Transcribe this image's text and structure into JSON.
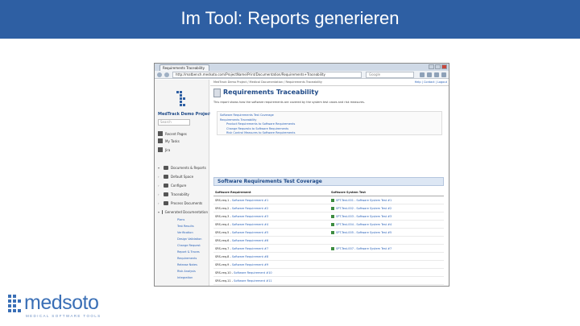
{
  "slide": {
    "title": "Im Tool: Reports generieren",
    "accent_color": "#2e5fa3"
  },
  "browser": {
    "tab_title": "Requirements Traceability",
    "url": "http://matbench.medsoto.com/ProjectName/Print/Documentation/Requirements+Traceability",
    "search_placeholder": "Google"
  },
  "sidebar": {
    "project_name": "MedTrack Demo Project",
    "search_placeholder": "Search",
    "items": [
      {
        "label": "Recent Pages",
        "icon": "clock-icon"
      },
      {
        "label": "My Tasks",
        "icon": "tasks-icon"
      },
      {
        "label": "Jira",
        "icon": "jira-icon"
      }
    ],
    "tree_root": "Documents & Reports",
    "tree": [
      {
        "label": "Default Space"
      },
      {
        "label": "Configure"
      },
      {
        "label": "Traceability"
      },
      {
        "label": "Process Documents"
      },
      {
        "label": "Generated Documentation"
      }
    ],
    "subitems": [
      "Plans",
      "Test Results",
      "Verification",
      "Design Validation",
      "Change Request",
      "Report & Traces",
      "Requirements",
      "Release Notes",
      "Risk Analysis",
      "Integration"
    ]
  },
  "main": {
    "breadcrumb": "MedTrack Demo Project / Medical Documentation / Requirements Traceability",
    "top_links": "Help | Contact | Logout",
    "page_title": "Requirements Traceability",
    "intro": "This report shows how the software requirements are covered by the system test cases and risk measures.",
    "toc": [
      {
        "label": "Software Requirements Test Coverage",
        "level": 1
      },
      {
        "label": "Requirements Traceability",
        "level": 1
      },
      {
        "label": "Product Requirements to Software Requirements",
        "level": 2
      },
      {
        "label": "Change Requests to Software Requirements",
        "level": 2
      },
      {
        "label": "Risk Control Measures to Software Requirements",
        "level": 2
      }
    ],
    "section_title": "Software Requirements Test Coverage",
    "columns": [
      "Software Requirement",
      "Software System Test"
    ],
    "rows": [
      {
        "id": "SRS-req-1",
        "title": "Software Requirement #1",
        "test": "SPT-Test-001 - Software System Test #1"
      },
      {
        "id": "SRS-req-2",
        "title": "Software Requirement #2",
        "test": "SPT-Test-002 - Software System Test #2"
      },
      {
        "id": "SRS-req-3",
        "title": "Software Requirement #3",
        "test": "SPT-Test-003 - Software System Test #3"
      },
      {
        "id": "SRS-req-4",
        "title": "Software Requirement #4",
        "test": "SPT-Test-004 - Software System Test #4"
      },
      {
        "id": "SRS-req-5",
        "title": "Software Requirement #5",
        "test": "SPT-Test-005 - Software System Test #5"
      },
      {
        "id": "SRS-req-6",
        "title": "Software Requirement #6",
        "test": ""
      },
      {
        "id": "SRS-req-7",
        "title": "Software Requirement #7",
        "test": "SPT-Test-007 - Software System Test #7"
      },
      {
        "id": "SRS-req-8",
        "title": "Software Requirement #8",
        "test": ""
      },
      {
        "id": "SRS-req-9",
        "title": "Software Requirement #9",
        "test": ""
      },
      {
        "id": "SRS-req-10",
        "title": "Software Requirement #10",
        "test": ""
      },
      {
        "id": "SRS-req-11",
        "title": "Software Requirement #11",
        "test": ""
      },
      {
        "id": "SRS-req-12",
        "title": "Software Requirement #12",
        "test": ""
      }
    ]
  },
  "brand": {
    "name": "medsoto",
    "tagline": "MEDICAL SOFTWARE TOOLS"
  }
}
